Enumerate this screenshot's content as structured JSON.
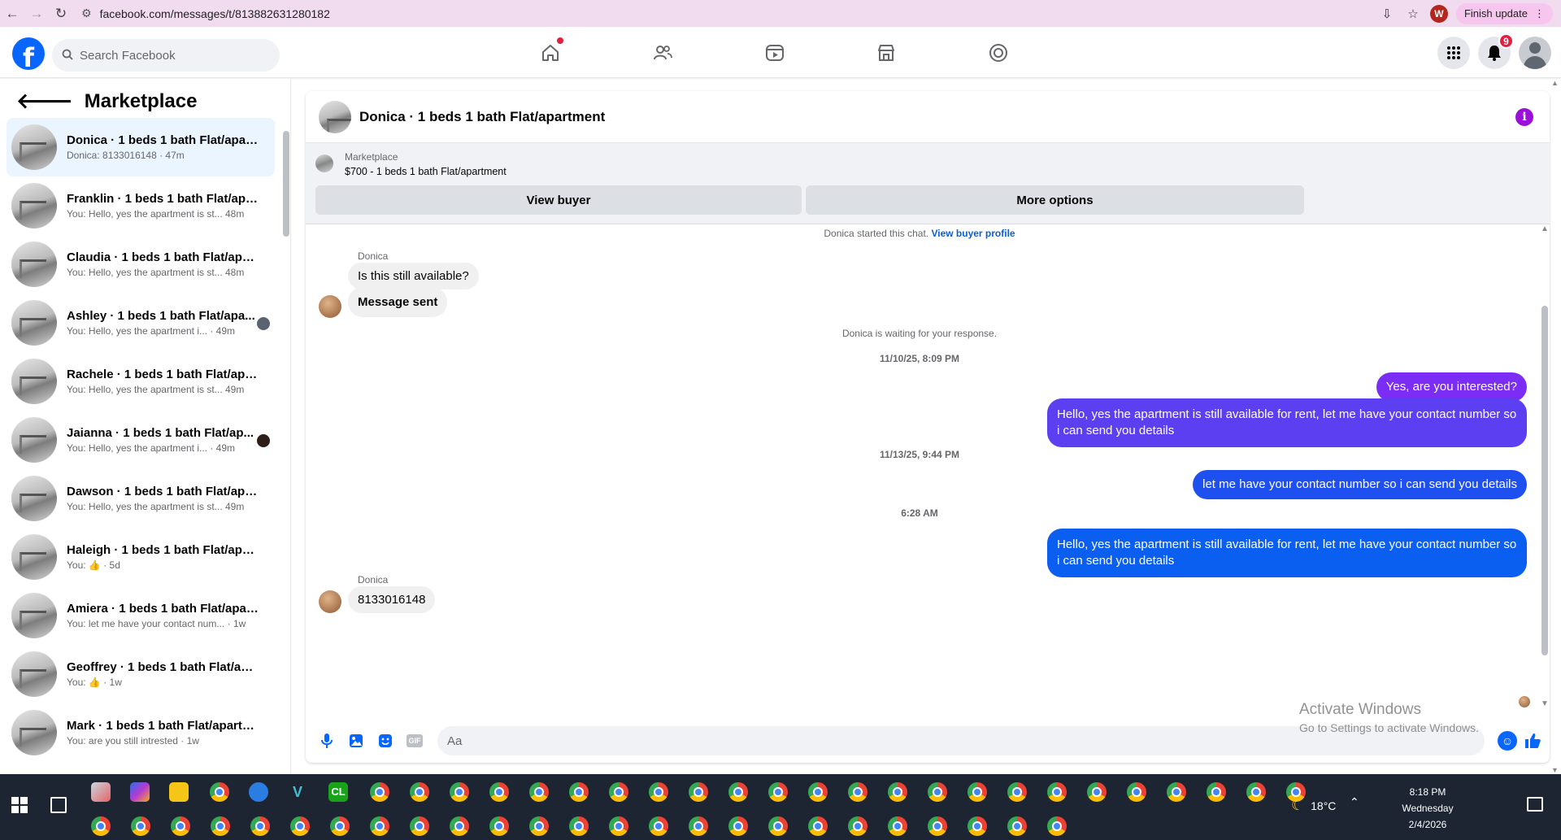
{
  "browser": {
    "url": "facebook.com/messages/t/813882631280182",
    "profile_initial": "W",
    "finish_update_label": "Finish update"
  },
  "header": {
    "logo_letter": "f",
    "search_placeholder": "Search Facebook",
    "notifications_count": "9"
  },
  "sidebar": {
    "title": "Marketplace",
    "conversations": [
      {
        "name": "Donica · 1 beds 1 bath Flat/apart...",
        "preview": "Donica: 8133016148 · 47m",
        "active": true
      },
      {
        "name": "Franklin · 1 beds 1 bath Flat/apar...",
        "preview": "You: Hello, yes the apartment is st... 48m"
      },
      {
        "name": "Claudia · 1 beds 1 bath Flat/apar...",
        "preview": "You: Hello, yes the apartment is st... 48m"
      },
      {
        "name": "Ashley · 1 beds 1 bath Flat/apa...",
        "preview": "You: Hello, yes the apartment i... · 49m"
      },
      {
        "name": "Rachele · 1 beds 1 bath Flat/apar...",
        "preview": "You: Hello, yes the apartment is st... 49m"
      },
      {
        "name": "Jaianna · 1 beds 1 bath Flat/ap...",
        "preview": "You: Hello, yes the apartment i... · 49m"
      },
      {
        "name": "Dawson · 1 beds 1 bath Flat/apar...",
        "preview": "You: Hello, yes the apartment is st... 49m"
      },
      {
        "name": "Haleigh · 1 beds 1 bath Flat/apar...",
        "preview": "You: 👍 · 5d"
      },
      {
        "name": "Amiera · 1 beds 1 bath Flat/apart...",
        "preview": "You: let me have your contact num... · 1w"
      },
      {
        "name": "Geoffrey · 1 beds 1 bath Flat/apa...",
        "preview": "You: 👍 · 1w"
      },
      {
        "name": "Mark · 1 beds 1 bath Flat/apartm...",
        "preview": "You: are you still intrested · 1w"
      }
    ]
  },
  "chat": {
    "title": "Donica · 1 beds 1 bath Flat/apartment",
    "marketplace_label": "Marketplace",
    "listing": "$700 - 1 beds 1 bath Flat/apartment",
    "view_buyer_label": "View buyer",
    "more_options_label": "More options",
    "started_note": "Donica started this chat.",
    "view_buyer_profile_link": "View buyer profile",
    "sender_name": "Donica",
    "msg_in_1": "Is this still available?",
    "msg_in_2": "Message sent",
    "waiting_note": "Donica is waiting for your response.",
    "timestamp_1": "11/10/25, 8:09 PM",
    "msg_out_1": "Yes, are you interested?",
    "msg_out_2": "Hello, yes the apartment is still available for rent, let me have your contact number so i can send you details",
    "timestamp_2": "11/13/25, 9:44 PM",
    "msg_out_3": "let me have your contact number so i can send you details",
    "timestamp_3": "6:28 AM",
    "msg_out_4": "Hello, yes the apartment is still available for rent, let me have your contact number so i can send you details",
    "msg_in_3": "8133016148",
    "composer_placeholder": "Aa",
    "gif_label": "GIF",
    "colors": {
      "outgoing_purple": "#7b2cf5",
      "outgoing_blue": "#0a5ef0",
      "accent": "#0866ff"
    }
  },
  "watermark": {
    "line1": "Activate Windows",
    "line2": "Go to Settings to activate Windows."
  },
  "taskbar": {
    "cl_label": "CL",
    "weather": "18°C",
    "time": "8:18 PM",
    "day": "Wednesday",
    "date": "2/4/2026"
  }
}
